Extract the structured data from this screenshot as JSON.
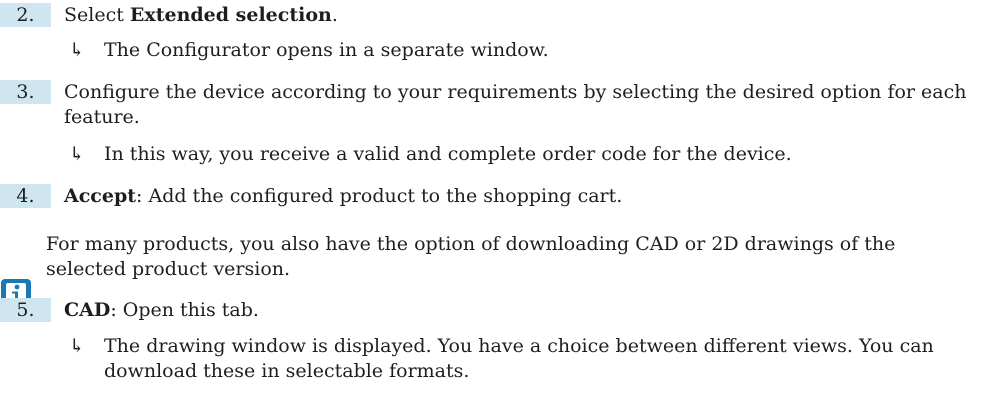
{
  "steps": [
    {
      "number": "2.",
      "bold": "Extended selection",
      "prefix": "Select ",
      "suffix": ".",
      "result": "The Configurator opens in a separate window."
    },
    {
      "number": "3.",
      "line1": "Configure the device according to your requirements by selecting the desired option for each",
      "line2": "feature.",
      "result": "In this way, you receive a valid and complete order code for the device."
    },
    {
      "number": "4.",
      "bold": "Accept",
      "rest": ": Add the configured product to the shopping cart."
    },
    {
      "number": "5.",
      "bold": "CAD",
      "rest": ": Open this tab.",
      "result_line1": "The drawing window is displayed. You have a choice between different views. You can",
      "result_line2": "download these in selectable formats."
    }
  ],
  "note": {
    "icon": "info-icon",
    "line1": "For many products, you also have the option of downloading CAD or 2D drawings of the",
    "line2": "selected product version."
  },
  "colors": {
    "badge_bg": "#cfe6f0",
    "icon_blue": "#1b78b5"
  },
  "arrow_glyph": "↳"
}
